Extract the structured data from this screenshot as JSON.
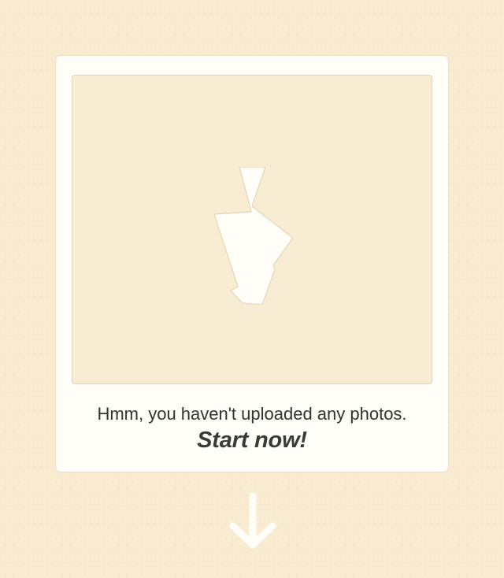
{
  "empty_state": {
    "message": "Hmm, you haven't uploaded any photos.",
    "cta_label": "Start now!",
    "placeholder_icon": "lightning-bolt-arrow-icon",
    "scroll_hint_icon": "arrow-down-icon"
  },
  "colors": {
    "background": "#f8ebcf",
    "card": "#fffdf7",
    "photo_area": "#f8ecd2",
    "text": "#333333",
    "icon_fill": "#fffdf7"
  }
}
